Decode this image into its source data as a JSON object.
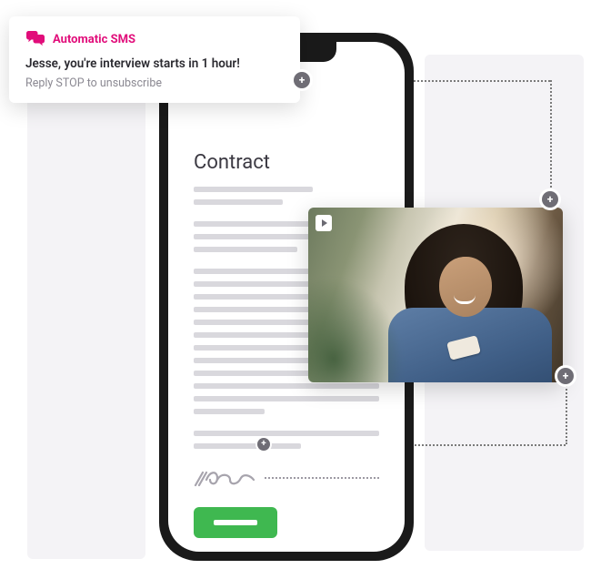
{
  "sms": {
    "title": "Automatic SMS",
    "body": "Jesse, you're interview starts in 1 hour!",
    "footer": "Reply STOP to unsubscribe"
  },
  "contract": {
    "heading": "Contract"
  },
  "colors": {
    "accent_pink": "#e10d7a",
    "primary_green": "#3fb850"
  },
  "icons": {
    "chat": "chat-bubbles-icon",
    "play": "play-icon",
    "plus": "+"
  }
}
